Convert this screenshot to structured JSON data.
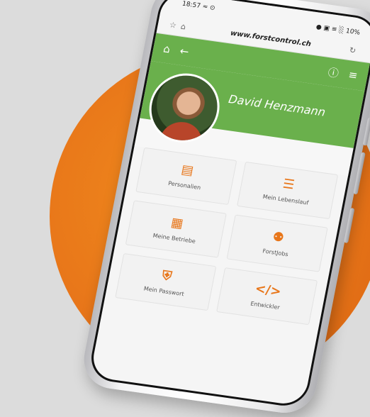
{
  "status": {
    "time": "18:57",
    "indicators_left": "≈ ⊙",
    "indicators_right": "● ▣ ≡ ░",
    "battery": "10%"
  },
  "browser": {
    "url": "www.forstcontrol.ch",
    "star_icon": "☆",
    "lock_icon": "⌂",
    "reload_icon": "↻"
  },
  "appbar": {
    "home_icon": "⌂",
    "back_icon": "←",
    "info_icon": "ⓘ",
    "menu_icon": "≡"
  },
  "profile": {
    "name": "David Henzmann"
  },
  "tiles": [
    {
      "label": "Personalien",
      "icon": "▤"
    },
    {
      "label": "Mein Lebenslauf",
      "icon": "☰"
    },
    {
      "label": "Meine Betriebe",
      "icon": "▦"
    },
    {
      "label": "ForstJobs",
      "icon": "⚉"
    },
    {
      "label": "Mein Passwort",
      "icon": "⛨"
    },
    {
      "label": "Entwickler",
      "icon": "</>"
    }
  ],
  "colors": {
    "accent_green": "#6ab04c",
    "accent_orange": "#e8761a"
  }
}
